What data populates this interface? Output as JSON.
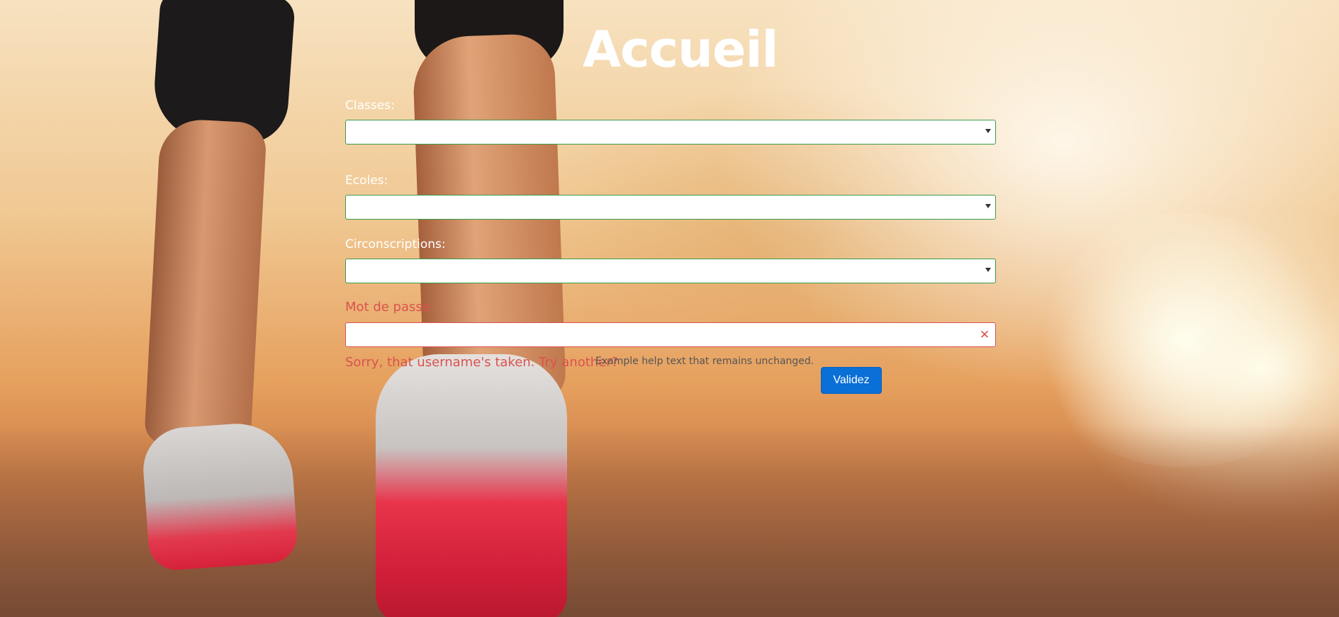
{
  "page": {
    "title": "Accueil",
    "background": "runner-shoes-sunset-photo"
  },
  "form": {
    "classes": {
      "label": "Classes:",
      "value": ""
    },
    "ecoles": {
      "label": "Ecoles:",
      "value": ""
    },
    "circonscriptions": {
      "label": "Circonscriptions:",
      "value": ""
    },
    "password": {
      "label": "Mot de passe",
      "value": "",
      "state": "error",
      "error_message": "Sorry, that username's taken. Try another?",
      "help_text": "Example help text that remains unchanged.",
      "clear_icon": "close-icon"
    },
    "submit_label": "Validez"
  },
  "colors": {
    "valid_border": "#3c9a4a",
    "error": "#d9534f",
    "button": "#0a6fd6",
    "title": "#ffffff"
  }
}
